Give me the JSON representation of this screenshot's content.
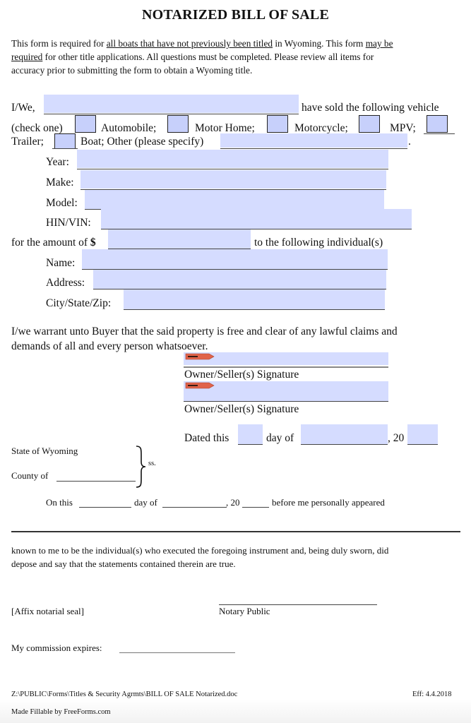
{
  "document": {
    "title": "NOTARIZED BILL OF SALE",
    "intro": {
      "part1": "This form is required for ",
      "underline1": "all boats that have not previously been titled",
      "part2": " in Wyoming. This form ",
      "underline2a": "may be",
      "underline2b": "required",
      "part3": " for other title applications. All questions must be completed.  Please review all items for",
      "line3": "accuracy prior to submitting the form to obtain a Wyoming title."
    },
    "seller": {
      "prefix": "I/We,",
      "suffix": "have sold the following vehicle",
      "value": ""
    },
    "vehicle_type": {
      "check_one": "(check one)",
      "options": [
        {
          "label": "Automobile;",
          "checked": false
        },
        {
          "label": "Motor Home;",
          "checked": false
        },
        {
          "label": "Motorcycle;",
          "checked": false
        },
        {
          "label": "MPV;",
          "checked": false
        },
        {
          "label": "Trailer;",
          "checked": false
        },
        {
          "label": "Boat; Other (please specify)",
          "checked": false
        }
      ],
      "other_value": "",
      "period": "."
    },
    "vehicle_fields": [
      {
        "label": "Year:",
        "value": ""
      },
      {
        "label": "Make:",
        "value": ""
      },
      {
        "label": "Model:",
        "value": ""
      },
      {
        "label": "HIN/VIN:",
        "value": ""
      }
    ],
    "amount": {
      "prefix": "for the amount of ",
      "currency": "$",
      "suffix": "to the following individual(s)",
      "value": ""
    },
    "buyer_fields": [
      {
        "label": "Name:",
        "value": ""
      },
      {
        "label": "Address:",
        "value": ""
      },
      {
        "label": "City/State/Zip:",
        "value": ""
      }
    ],
    "warranty": {
      "line1": "I/we warrant unto Buyer that the said property is free and clear of any lawful claims and",
      "line2": "demands of all and every person whatsoever."
    },
    "signatures": [
      {
        "label": "Owner/Seller(s) Signature",
        "tag": "SIGN HERE"
      },
      {
        "label": "Owner/Seller(s) Signature",
        "tag": "SIGN HERE"
      }
    ],
    "dated": {
      "prefix": "Dated this",
      "day_of": "day of",
      "year_prefix": ", 20",
      "day_value": "",
      "month_value": "",
      "year_value": ""
    },
    "notary": {
      "state": "State of Wyoming",
      "county": "County of",
      "ss": "ss.",
      "on_this": "On this",
      "day_of": "day of",
      "year_prefix": ", 20",
      "appeared": "before me personally appeared",
      "known_line1": "known to me to be the individual(s) who executed the foregoing instrument and, being duly sworn, did",
      "known_line2": "depose and say that the statements contained therein are true.",
      "seal": "[Affix notarial seal]",
      "notary_public": "Notary Public",
      "commission": "My commission expires:"
    },
    "footer": {
      "path": "Z:\\PUBLIC\\Forms\\Titles & Security Agrmts\\BILL OF SALE Notarized.doc",
      "effective": "Eff:  4.4.2018",
      "made_fillable": "Made Fillable by FreeForms.com"
    }
  },
  "colors": {
    "field_fill": "#d5dcff",
    "checkbox_fill": "#c7d0fb",
    "sign_tag": "#e0634a"
  }
}
